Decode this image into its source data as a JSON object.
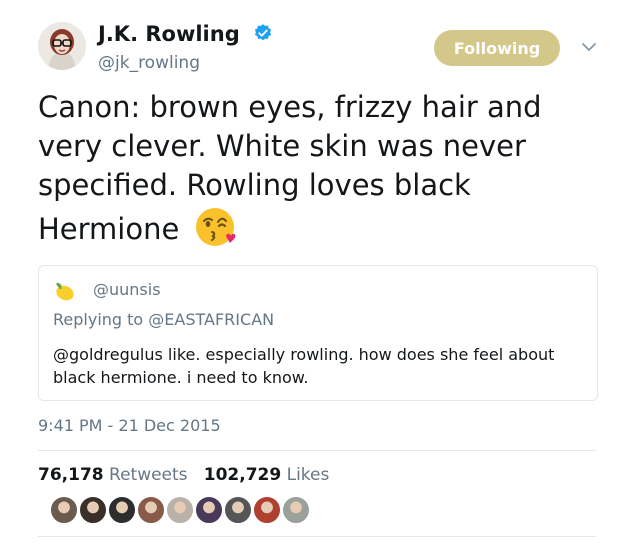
{
  "author": {
    "name": "J.K. Rowling",
    "handle": "@jk_rowling",
    "verified": true,
    "avatar_icon": "jk-rowling-avatar"
  },
  "follow_button": {
    "label": "Following",
    "color": "#d3c78a"
  },
  "tweet": {
    "text": "Canon: brown eyes, frizzy hair and very clever. White skin was never specified. Rowling loves black Hermione",
    "emoji_icon": "face-blowing-kiss-emoji"
  },
  "quoted_tweet": {
    "handle": "@uunsis",
    "reply_label": "Replying to @EASTAFRICAN",
    "text": "@goldregulus like. especially rowling. how does she feel about black hermione. i need to know.",
    "emoji_icon": "lemon-emoji"
  },
  "timestamp": "9:41 PM - 21 Dec 2015",
  "stats": {
    "retweets_count": "76,178",
    "retweets_label": "Retweets",
    "likes_count": "102,729",
    "likes_label": "Likes"
  },
  "likers": [
    {
      "color": "#6b5a4e"
    },
    {
      "color": "#3b2f2a"
    },
    {
      "color": "#2d2d2d"
    },
    {
      "color": "#8a5a48"
    },
    {
      "color": "#b8b2a8"
    },
    {
      "color": "#4a3a5a"
    },
    {
      "color": "#555555"
    },
    {
      "color": "#b04030"
    },
    {
      "color": "#9aa09a"
    }
  ]
}
